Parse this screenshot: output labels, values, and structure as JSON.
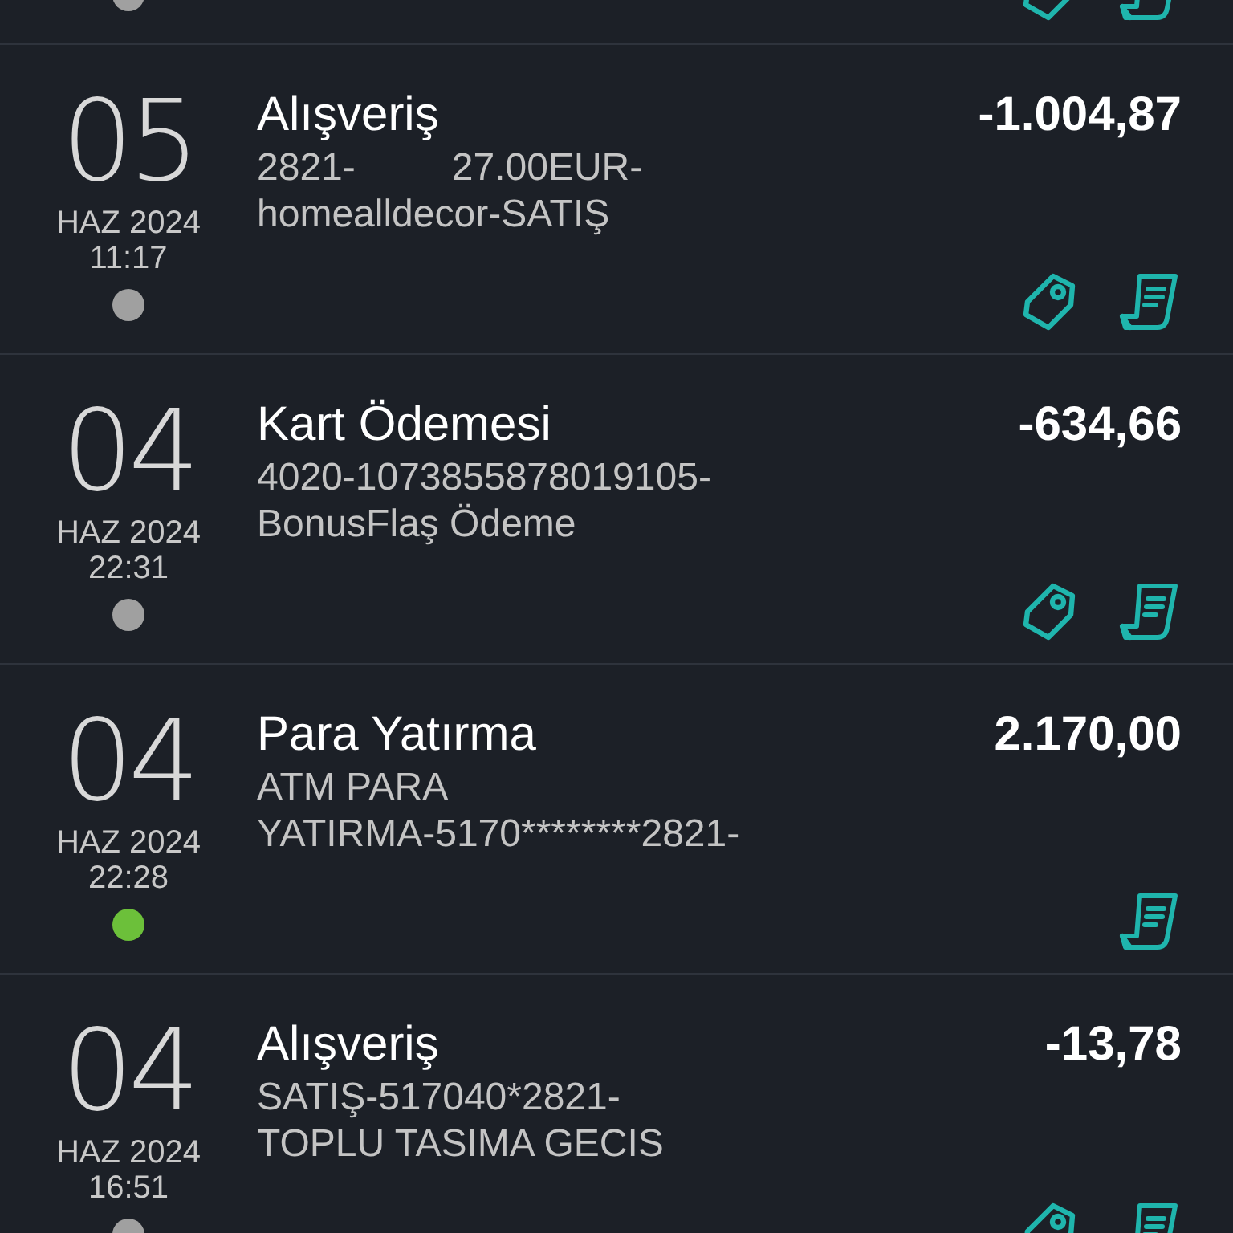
{
  "transactions": [
    {
      "color": "#a0a0a0",
      "icons": [
        {
          "kind": "tag"
        },
        {
          "kind": "receipt"
        }
      ]
    },
    {
      "day": "05",
      "month_year": "HAZ 2024",
      "time": "11:17",
      "title": "Alışveriş",
      "description_lines": [
        "2821-         27.00EUR-",
        "homealldecor-SATIŞ"
      ],
      "amount": "-1.004,87",
      "color": "#a0a0a0",
      "icons": [
        {
          "kind": "tag"
        },
        {
          "kind": "receipt"
        }
      ]
    },
    {
      "day": "04",
      "month_year": "HAZ 2024",
      "time": "22:31",
      "title": "Kart Ödemesi",
      "description_lines": [
        "4020-1073855878019105-",
        "BonusFlaş Ödeme"
      ],
      "amount": "-634,66",
      "color": "#a0a0a0",
      "icons": [
        {
          "kind": "tag"
        },
        {
          "kind": "receipt"
        }
      ]
    },
    {
      "day": "04",
      "month_year": "HAZ 2024",
      "time": "22:28",
      "title": "Para Yatırma",
      "description_lines": [
        "ATM PARA",
        "YATIRMA-5170********2821-"
      ],
      "amount": "2.170,00",
      "color": "#6cc03a",
      "icons": [
        {
          "kind": "receipt"
        }
      ]
    },
    {
      "day": "04",
      "month_year": "HAZ 2024",
      "time": "16:51",
      "title": "Alışveriş",
      "description_lines": [
        "SATIŞ-517040*2821-",
        "TOPLU TASIMA GECIS"
      ],
      "amount": "-13,78",
      "color": "#a0a0a0",
      "icons": [
        {
          "kind": "tag"
        },
        {
          "kind": "receipt"
        }
      ]
    }
  ]
}
